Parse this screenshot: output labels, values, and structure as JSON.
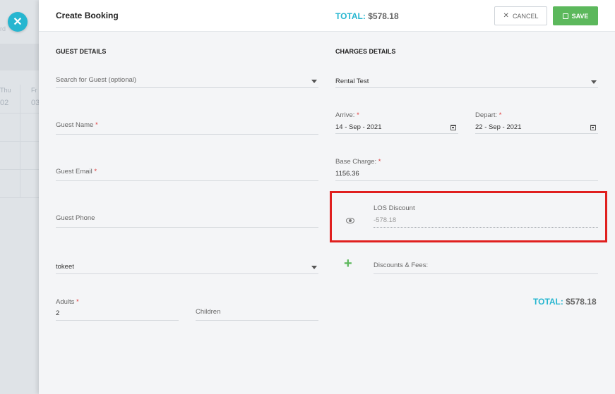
{
  "background": {
    "faint_text": "rd",
    "days": [
      {
        "name": "Thu",
        "num": "02"
      },
      {
        "name": "Fr",
        "num": "03"
      }
    ]
  },
  "header": {
    "title": "Create Booking",
    "total_label": "TOTAL:",
    "total_value": "$578.18",
    "cancel_label": "CANCEL",
    "save_label": "SAVE"
  },
  "guest": {
    "section_title": "GUEST DETAILS",
    "search_placeholder": "Search for Guest (optional)",
    "name_label": "Guest Name",
    "email_label": "Guest Email",
    "phone_label": "Guest Phone",
    "source_value": "tokeet",
    "adults_label": "Adults",
    "adults_value": "2",
    "children_label": "Children",
    "required_mark": "*"
  },
  "charges": {
    "section_title": "CHARGES DETAILS",
    "rental_value": "Rental Test",
    "arrive_label": "Arrive:",
    "arrive_value": "14 - Sep - 2021",
    "depart_label": "Depart:",
    "depart_value": "22 - Sep - 2021",
    "base_label": "Base Charge:",
    "base_value": "1156.36",
    "los_label": "LOS Discount",
    "los_value": "-578.18",
    "discounts_label": "Discounts & Fees:",
    "total_label": "TOTAL:",
    "total_value": "$578.18"
  },
  "colors": {
    "accent": "#26b6d0",
    "save": "#5cb85c",
    "highlight": "#e0201f",
    "required": "#e03a3a"
  }
}
